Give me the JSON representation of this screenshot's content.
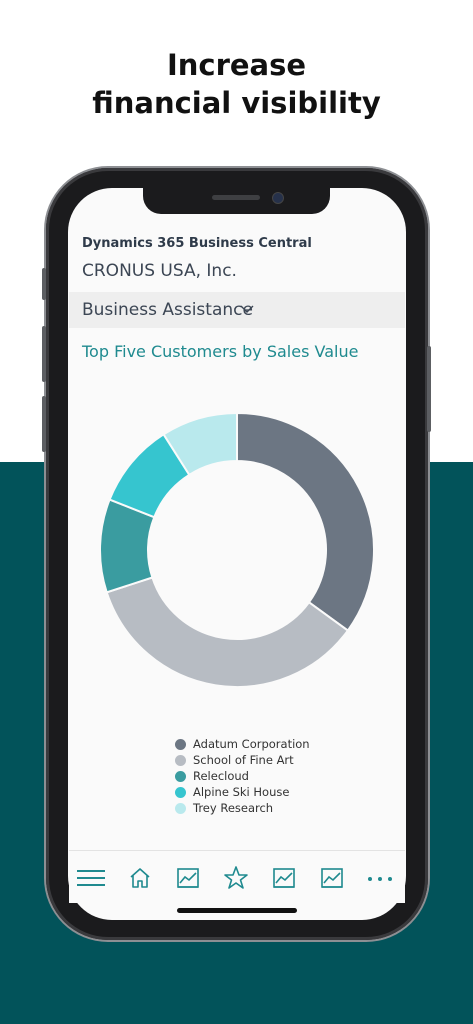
{
  "headline": {
    "line1": "Increase",
    "line2": "financial visibility"
  },
  "app": {
    "name": "Dynamics 365 Business Central",
    "company": "CRONUS USA, Inc.",
    "section": "Business Assistance"
  },
  "chart_data": {
    "type": "pie",
    "title": "Top Five Customers by Sales Value",
    "variant": "donut",
    "categories": [
      "Adatum Corporation",
      "School of Fine Art",
      "Relecloud",
      "Alpine Ski House",
      "Trey Research"
    ],
    "values": [
      35,
      35,
      11,
      10,
      9
    ],
    "colors": [
      "#6c7683",
      "#b7bcc3",
      "#3a9ca0",
      "#36c5cf",
      "#b9e9ed"
    ],
    "legend_position": "bottom"
  },
  "tabs": [
    {
      "name": "menu-icon"
    },
    {
      "name": "home-icon"
    },
    {
      "name": "chart-icon"
    },
    {
      "name": "star-icon"
    },
    {
      "name": "chart-icon"
    },
    {
      "name": "chart-icon"
    },
    {
      "name": "more-icon"
    }
  ],
  "colors": {
    "accent": "#1f8a8f",
    "background_band": "#02535a"
  }
}
